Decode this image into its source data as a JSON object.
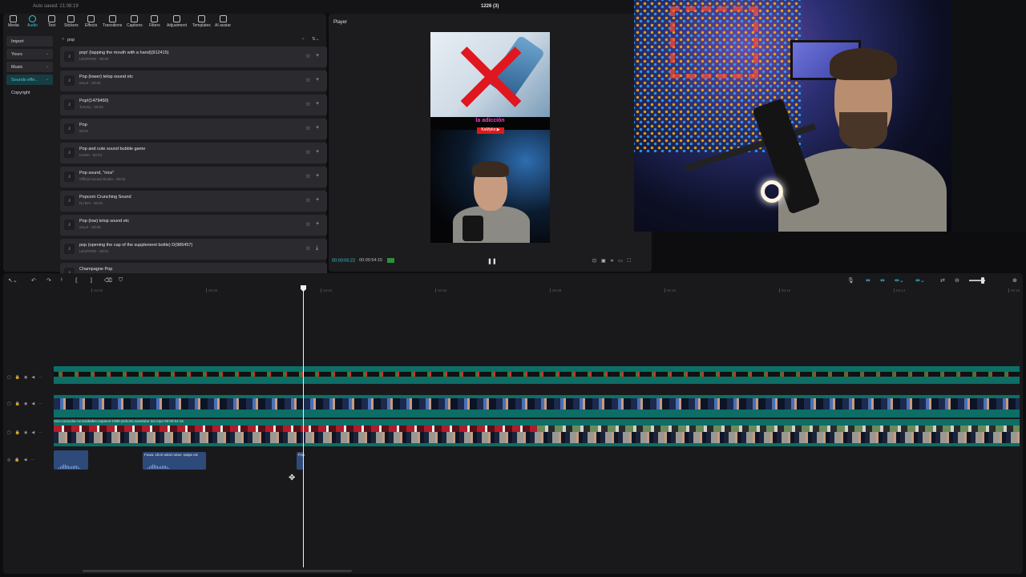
{
  "titlebar": {
    "autosave": "Auto saved: 21:08:19",
    "project_title": "1226 (3)"
  },
  "toolbar": {
    "tabs": [
      {
        "label": "Media"
      },
      {
        "label": "Audio"
      },
      {
        "label": "Text"
      },
      {
        "label": "Stickers"
      },
      {
        "label": "Effects"
      },
      {
        "label": "Transitions"
      },
      {
        "label": "Captions"
      },
      {
        "label": "Filters"
      },
      {
        "label": "Adjustment"
      },
      {
        "label": "Templates"
      },
      {
        "label": "AI avatar"
      }
    ],
    "active": "Audio"
  },
  "categories": [
    {
      "label": "Import"
    },
    {
      "label": "Yours"
    },
    {
      "label": "Music"
    },
    {
      "label": "Sounds effe..."
    },
    {
      "label": "Copyright"
    }
  ],
  "search": {
    "value": "pop"
  },
  "sounds": [
    {
      "name": "pop! (tapping the mouth with a hand)(912415)",
      "sub": "LEOPARD - 00:00"
    },
    {
      "name": "Pop (lower) telop sound etc",
      "sub": "emuri - 00:00"
    },
    {
      "name": "Pop!(1479450)",
      "sub": "Tommy - 00:03"
    },
    {
      "name": "Pop",
      "sub": "00:01"
    },
    {
      "name": "Pop and cute sound bubble game",
      "sub": "HAMA - 00:03"
    },
    {
      "name": "Pop sound, \"nice\"",
      "sub": "Official Sound Studio - 00:02"
    },
    {
      "name": "Popcorn Crunching Sound",
      "sub": "DJ BAI - 00:01"
    },
    {
      "name": "Pop (low) telop sound etc",
      "sub": "emuri - 00:00"
    },
    {
      "name": "pop (opening the cap of the supplement bottle) D(986457)",
      "sub": "LEOPARD - 00:01"
    },
    {
      "name": "Champagne Pop",
      "sub": ""
    }
  ],
  "player": {
    "title": "Player",
    "caption": "la adicción",
    "badge": "KaMyko ▶",
    "time_current": "00:00:05:22",
    "time_total": "00:00:54:15"
  },
  "timeline": {
    "ruler": [
      "00:00",
      "00:02",
      "00:04",
      "00:06",
      "00:08",
      "00:10",
      "00:12",
      "00:14",
      "00:16",
      "00:18"
    ],
    "video_caption": "ntra-cocacola-curiosidades-espanol-1080-ytshorts.savetube.me.mp4   00:00:54:15",
    "audio_clip_1": "Fuwa: short wind noise: swipe etc",
    "audio_clip_2": "Pop"
  },
  "colors": {
    "accent": "#36c6cf",
    "track": "#0d6e66",
    "audio_clip": "#2e4a7a"
  }
}
